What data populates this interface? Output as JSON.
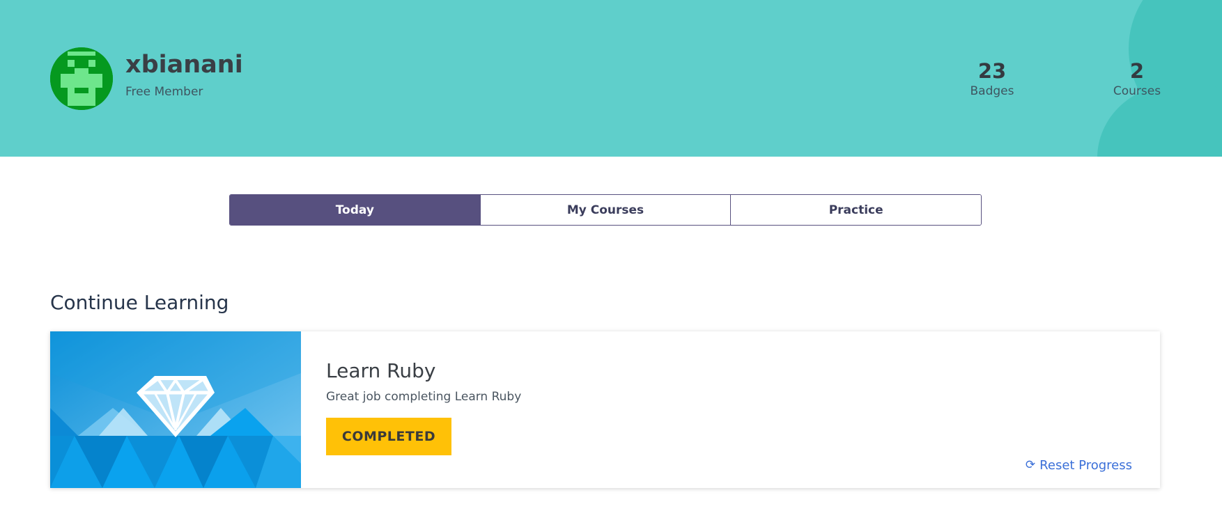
{
  "profile": {
    "username": "xbianani",
    "membership": "Free Member"
  },
  "stats": {
    "badges": {
      "value": "23",
      "label": "Badges"
    },
    "courses": {
      "value": "2",
      "label": "Courses"
    }
  },
  "tabs": [
    {
      "label": "Today",
      "active": true
    },
    {
      "label": "My Courses",
      "active": false
    },
    {
      "label": "Practice",
      "active": false
    }
  ],
  "continue_learning": {
    "title": "Continue Learning",
    "course": {
      "title": "Learn Ruby",
      "subtitle": "Great job completing Learn Ruby",
      "status_label": "COMPLETED",
      "reset_label": "Reset Progress",
      "image_icon": "ruby-gem-icon"
    }
  },
  "colors": {
    "header_bg": "#5fcfcb",
    "tab_active": "#57507f",
    "completed": "#ffc107",
    "link": "#3a6fd8"
  }
}
